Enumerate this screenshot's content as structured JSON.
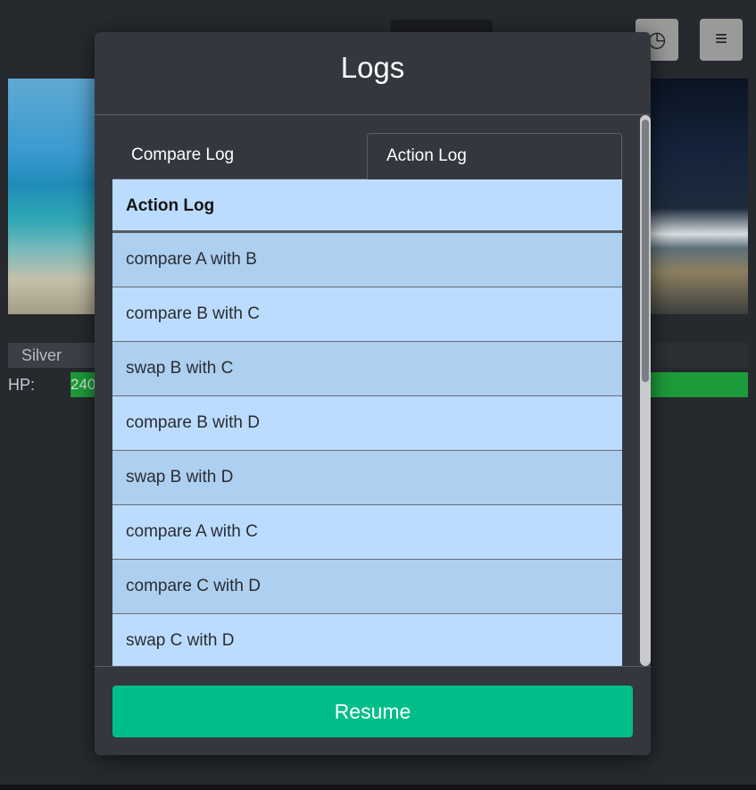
{
  "background": {
    "card_left": {
      "name": "Silver",
      "hp_label": "HP:",
      "hp_value": "240"
    }
  },
  "icons": {
    "history": "history-icon",
    "menu": "hamburger-menu-icon"
  },
  "modal": {
    "title": "Logs",
    "tabs": [
      {
        "label": "Compare Log",
        "active": false
      },
      {
        "label": "Action Log",
        "active": true
      }
    ],
    "table_header": "Action Log",
    "rows": [
      "compare A with B",
      "compare B with C",
      "swap B with C",
      "compare B with D",
      "swap B with D",
      "compare A with C",
      "compare C with D",
      "swap C with D"
    ],
    "resume_label": "Resume"
  },
  "colors": {
    "accent": "#00be8a",
    "row_light": "#bcdcff",
    "row_dark": "#adcff0",
    "modal_bg": "#34373e"
  }
}
